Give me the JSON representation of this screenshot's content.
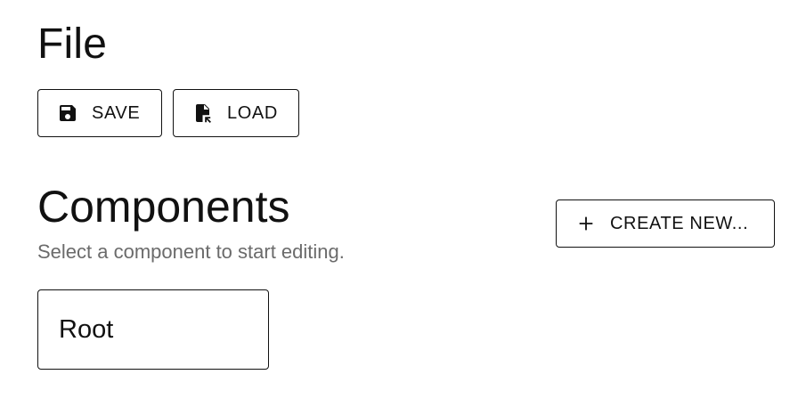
{
  "file": {
    "title": "File",
    "save_label": "SAVE",
    "load_label": "LOAD",
    "save_icon": "save-icon",
    "load_icon": "file-open-icon"
  },
  "components": {
    "title": "Components",
    "subtitle": "Select a component to start editing.",
    "create_label": "CREATE NEW...",
    "create_icon": "plus-icon",
    "items": [
      {
        "label": "Root"
      }
    ]
  },
  "colors": {
    "text": "#111111",
    "muted": "#6b6b6b",
    "border": "#111111",
    "background": "#ffffff"
  }
}
